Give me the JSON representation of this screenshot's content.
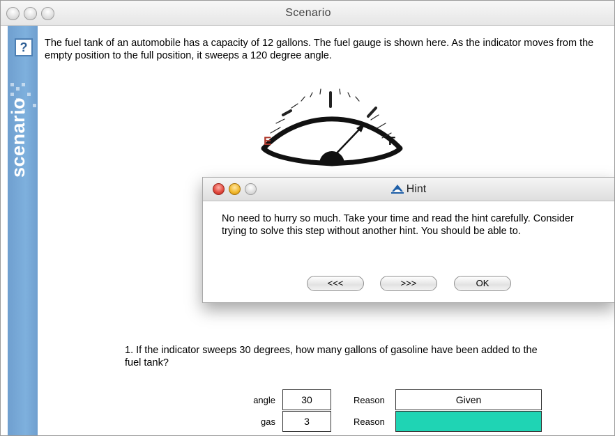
{
  "window": {
    "title": "Scenario"
  },
  "sidebar": {
    "help": "?",
    "brand": "scenario"
  },
  "intro": "The fuel tank of an automobile has a capacity of 12 gallons. The fuel gauge is shown here. As the indicator moves from the empty position to the full position, it sweeps a 120 degree angle.",
  "gauge": {
    "empty_label": "E",
    "full_label": "F",
    "empty_color": "#b03a2e"
  },
  "hint": {
    "title": "Hint",
    "text": "No need to hurry so much. Take your time and read the hint carefully. Consider trying to solve this step without another hint. You should be able to.",
    "prev": "<<<",
    "next": ">>>",
    "ok": "OK"
  },
  "question": "1. If the indicator sweeps 30 degrees, how many gallons of gasoline have been added to the fuel tank?",
  "table": {
    "rows": [
      {
        "label": "angle",
        "value": "30",
        "reason_label": "Reason",
        "reason": "Given"
      },
      {
        "label": "gas",
        "value": "3",
        "reason_label": "Reason",
        "reason": ""
      }
    ],
    "highlight_color": "#1fd4b4"
  }
}
